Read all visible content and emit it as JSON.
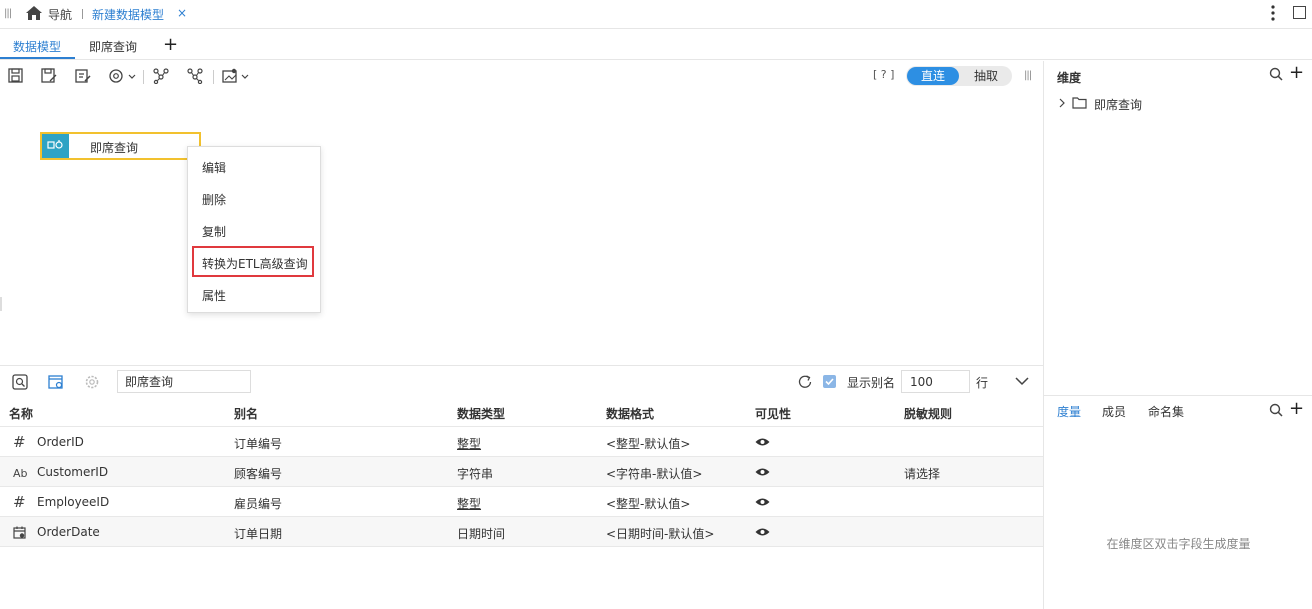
{
  "topbar": {
    "nav_label": "导航",
    "tab_title": "新建数据模型",
    "tab_close": "×"
  },
  "tabs": [
    {
      "label": "数据模型",
      "active": true
    },
    {
      "label": "即席查询",
      "active": false
    }
  ],
  "tabs_add": "+",
  "toolbar": {
    "help": "[ ? ]",
    "mode_on": "直连",
    "mode_off": "抽取"
  },
  "canvas": {
    "node_label": "即席查询"
  },
  "context_menu": {
    "items": [
      "编辑",
      "删除",
      "复制",
      "转换为ETL高级查询",
      "属性"
    ],
    "highlighted": "转换为ETL高级查询"
  },
  "lower_toolbar": {
    "query_value": "即席查询",
    "show_alias_label": "显示别名",
    "rows_value": "100",
    "rows_unit": "行"
  },
  "table": {
    "headers": [
      "名称",
      "别名",
      "数据类型",
      "数据格式",
      "可见性",
      "脱敏规则"
    ],
    "rows": [
      {
        "type_icon": "#",
        "name": "OrderID",
        "alias": "订单编号",
        "dtype": "整型",
        "format": "<整型-默认值>",
        "mask": ""
      },
      {
        "type_icon": "Ab",
        "name": "CustomerID",
        "alias": "顾客编号",
        "dtype": "字符串",
        "format": "<字符串-默认值>",
        "mask": "请选择"
      },
      {
        "type_icon": "#",
        "name": "EmployeeID",
        "alias": "雇员编号",
        "dtype": "整型",
        "format": "<整型-默认值>",
        "mask": ""
      },
      {
        "type_icon": "calendar",
        "name": "OrderDate",
        "alias": "订单日期",
        "dtype": "日期时间",
        "format": "<日期时间-默认值>",
        "mask": ""
      }
    ]
  },
  "right_panel": {
    "dimension_title": "维度",
    "tree_item": "即席查询",
    "tabs": [
      "度量",
      "成员",
      "命名集"
    ],
    "empty_text": "在维度区双击字段生成度量"
  },
  "colors": {
    "accent": "#2d7fd1",
    "node_border": "#f2c12e",
    "node_icon_bg": "#2fa3c4",
    "highlight_border": "#e0393e"
  }
}
